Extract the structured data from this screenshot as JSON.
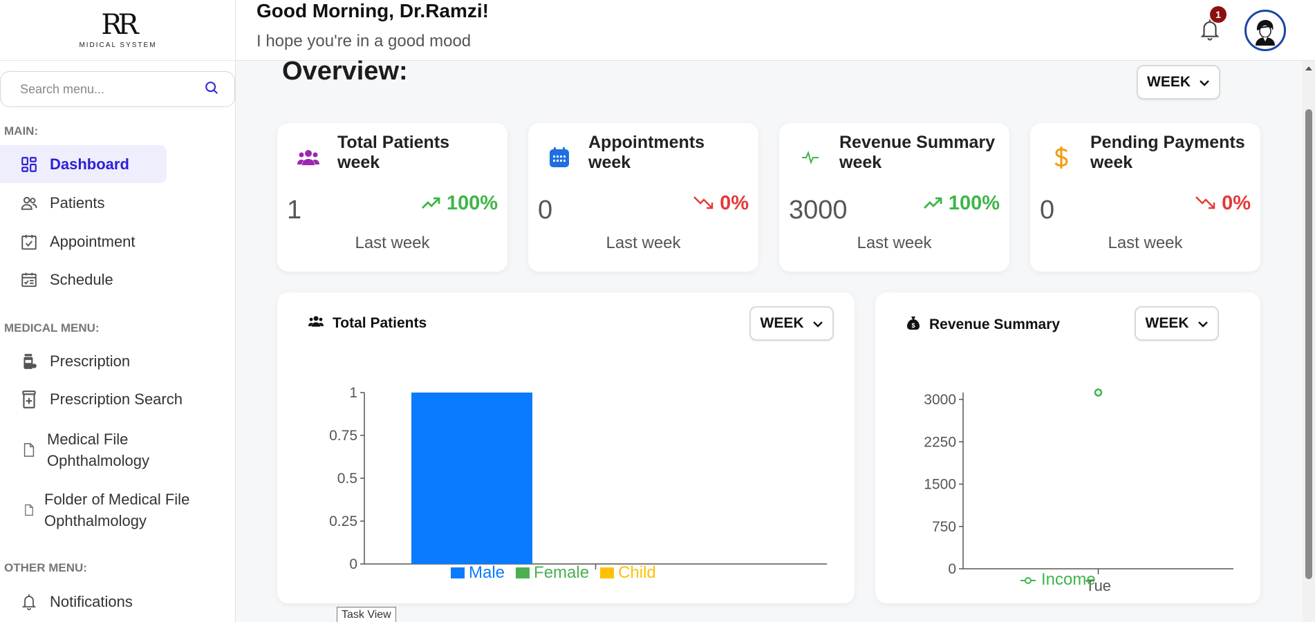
{
  "logo": {
    "mark": "RR",
    "subtitle": "MIDICAL SYSTEM"
  },
  "header": {
    "greeting": "Good Morning, Dr.Ramzi!",
    "subtitle": "I hope you're in a good mood",
    "notification_count": "1"
  },
  "sidebar": {
    "search_placeholder": "Search menu...",
    "sections": {
      "main": "MAIN:",
      "medical": "MEDICAL MENU:",
      "other": "OTHER MENU:"
    },
    "items": {
      "dashboard": "Dashboard",
      "patients": "Patients",
      "appointment": "Appointment",
      "schedule": "Schedule",
      "prescription": "Prescription",
      "prescription_search": "Prescription Search",
      "medical_file_1": "Medical File",
      "medical_file_2": "Ophthalmology",
      "folder_1": "Folder of Medical File",
      "folder_2": "Ophthalmology",
      "notifications": "Notifications"
    }
  },
  "overview": {
    "title": "Overview:",
    "period": "WEEK"
  },
  "stats": [
    {
      "title": "Total Patients week",
      "value": "1",
      "change": "100%",
      "trend": "up",
      "footer": "Last week",
      "icon": "users-icon",
      "color": "#9c27b0"
    },
    {
      "title": "Appointments week",
      "value": "0",
      "change": "0%",
      "trend": "down",
      "footer": "Last week",
      "icon": "calendar-icon",
      "color": "#1e6fe0"
    },
    {
      "title": "Revenue Summary week",
      "value": "3000",
      "change": "100%",
      "trend": "up",
      "footer": "Last week",
      "icon": "pulse-icon",
      "color": "#3db648"
    },
    {
      "title": "Pending Payments week",
      "value": "0",
      "change": "0%",
      "trend": "down",
      "footer": "Last week",
      "icon": "dollar-icon",
      "color": "#f39c12"
    }
  ],
  "patients_chart": {
    "title": "Total Patients",
    "period": "WEEK"
  },
  "revenue_chart": {
    "title": "Revenue Summary",
    "period": "WEEK"
  },
  "chart_data": [
    {
      "type": "bar",
      "title": "Total Patients",
      "categories": [
        ""
      ],
      "series": [
        {
          "name": "Male",
          "values": [
            1
          ],
          "color": "#0a7bff"
        },
        {
          "name": "Female",
          "values": [
            0
          ],
          "color": "#4caf50"
        },
        {
          "name": "Child",
          "values": [
            0
          ],
          "color": "#ffc107"
        }
      ],
      "yticks": [
        "0",
        "0.25",
        "0.5",
        "0.75",
        "1"
      ],
      "ylim": [
        0,
        1
      ]
    },
    {
      "type": "line",
      "title": "Revenue Summary",
      "categories": [
        "Tue"
      ],
      "series": [
        {
          "name": "Income",
          "values": [
            3000
          ],
          "color": "#3db648"
        }
      ],
      "yticks": [
        "0",
        "750",
        "1500",
        "2250",
        "3000"
      ],
      "ylim": [
        0,
        3000
      ]
    }
  ],
  "tooltip": "Task View"
}
